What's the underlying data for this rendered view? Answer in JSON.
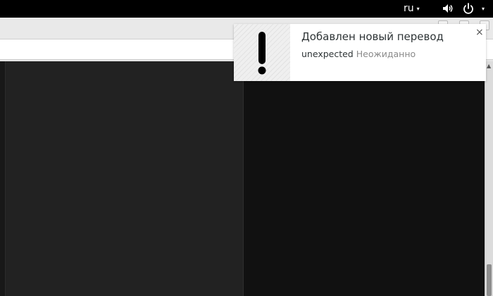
{
  "topbar": {
    "language": "ru",
    "language_arrow": "▾",
    "volume_icon": "speaker-volume-icon",
    "power_icon": "power-icon",
    "power_arrow": "▾"
  },
  "notification": {
    "title": "Добавлен новый перевод",
    "source_word": "unexpected",
    "translation": "Неожиданно",
    "close_symbol": "×",
    "icon": "exclamation-icon"
  },
  "window": {
    "scroll_up_symbol": "▲"
  },
  "colors": {
    "topbar_bg": "#000000",
    "left_pane_bg": "#222222",
    "right_pane_bg": "#111111",
    "notification_bg": "#ffffff",
    "secondary_text": "#8a8a8a"
  }
}
